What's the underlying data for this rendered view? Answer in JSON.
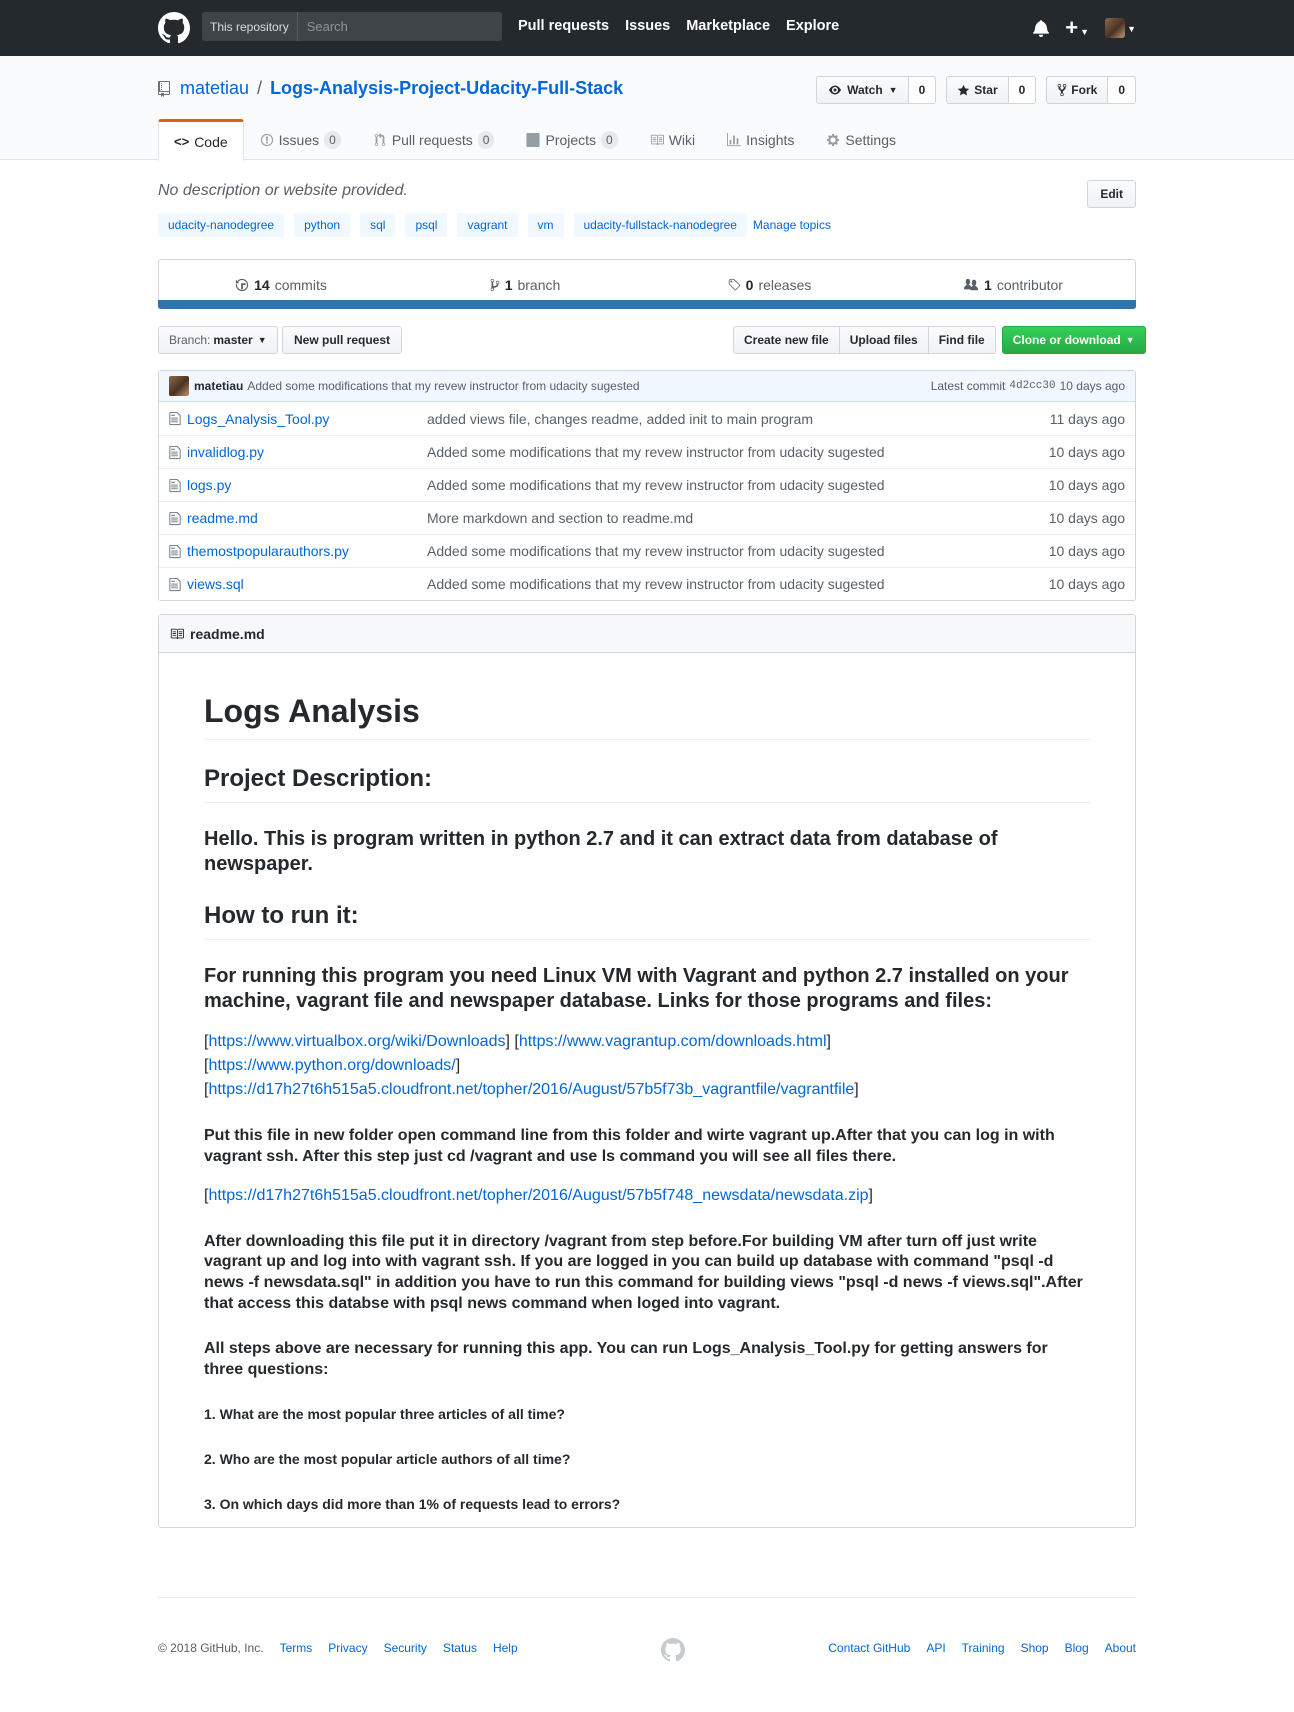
{
  "header": {
    "search_scope": "This repository",
    "search_placeholder": "Search",
    "nav": [
      "Pull requests",
      "Issues",
      "Marketplace",
      "Explore"
    ]
  },
  "repo": {
    "owner": "matetiau",
    "separator": "/",
    "name": "Logs-Analysis-Project-Udacity-Full-Stack",
    "watch_label": "Watch",
    "watch_count": "0",
    "star_label": "Star",
    "star_count": "0",
    "fork_label": "Fork",
    "fork_count": "0"
  },
  "tabs": [
    {
      "label": "Code",
      "counter": ""
    },
    {
      "label": "Issues",
      "counter": "0"
    },
    {
      "label": "Pull requests",
      "counter": "0"
    },
    {
      "label": "Projects",
      "counter": "0"
    },
    {
      "label": "Wiki",
      "counter": ""
    },
    {
      "label": "Insights",
      "counter": ""
    },
    {
      "label": "Settings",
      "counter": ""
    }
  ],
  "description": "No description or website provided.",
  "edit_label": "Edit",
  "topics": [
    "udacity-nanodegree",
    "python",
    "sql",
    "psql",
    "vagrant",
    "vm",
    "udacity-fullstack-nanodegree"
  ],
  "manage_topics": "Manage topics",
  "summary": {
    "commits_count": "14",
    "commits_label": "commits",
    "branch_count": "1",
    "branch_label": "branch",
    "releases_count": "0",
    "releases_label": "releases",
    "contributor_count": "1",
    "contributor_label": "contributor"
  },
  "colors": {
    "language_bar": "#3572a5",
    "header_bg": "#24292e",
    "clone_green": "#28a745"
  },
  "filenav": {
    "branch_prefix": "Branch:",
    "branch_name": "master",
    "new_pr": "New pull request",
    "create_file": "Create new file",
    "upload": "Upload files",
    "find": "Find file",
    "clone": "Clone or download"
  },
  "commit_tease": {
    "author": "matetiau",
    "message": "Added some modifications that my revew instructor from udacity sugested",
    "latest_label": "Latest commit",
    "sha": "4d2cc30",
    "age": "10 days ago"
  },
  "files": [
    {
      "name": "Logs_Analysis_Tool.py",
      "message": "added views file, changes readme, added init to main program",
      "age": "11 days ago"
    },
    {
      "name": "invalidlog.py",
      "message": "Added some modifications that my revew instructor from udacity sugested",
      "age": "10 days ago"
    },
    {
      "name": "logs.py",
      "message": "Added some modifications that my revew instructor from udacity sugested",
      "age": "10 days ago"
    },
    {
      "name": "readme.md",
      "message": "More markdown and section to readme.md",
      "age": "10 days ago"
    },
    {
      "name": "themostpopularauthors.py",
      "message": "Added some modifications that my revew instructor from udacity sugested",
      "age": "10 days ago"
    },
    {
      "name": "views.sql",
      "message": "Added some modifications that my revew instructor from udacity sugested",
      "age": "10 days ago"
    }
  ],
  "readme": {
    "filename": "readme.md",
    "h1": "Logs Analysis",
    "h2_desc": "Project Description:",
    "h3_hello": "Hello. This is program written in python 2.7 and it can extract data from database of newspaper.",
    "h2_run": "How to run it:",
    "h3_run": "For running this program you need Linux VM with Vagrant and python 2.7 installed on your machine, vagrant file and newspaper database. Links for those programs and files:",
    "link1": "https://www.virtualbox.org/wiki/Downloads",
    "link2": "https://www.vagrantup.com/downloads.html",
    "link3": "https://www.python.org/downloads/",
    "link4": "https://d17h27t6h515a5.cloudfront.net/topher/2016/August/57b5f73b_vagrantfile/vagrantfile",
    "h4_vagrant": "Put this file in new folder open command line from this folder and wirte vagrant up.After that you can log in with vagrant ssh. After this step just cd /vagrant and use ls command you will see all files there.",
    "link5": "https://d17h27t6h515a5.cloudfront.net/topher/2016/August/57b5f748_newsdata/newsdata.zip",
    "h4_db": "After downloading this file put it in directory /vagrant from step before.For building VM after turn off just write vagrant up and log into with vagrant ssh. If you are logged in you can build up database with command \"psql -d news -f newsdata.sql\" in addition you have to run this command for building views \"psql -d news -f views.sql\".After that access this databse with psql news command when loged into vagrant.",
    "h4_steps": "All steps above are necessary for running this app. You can run Logs_Analysis_Tool.py for getting answers for three questions:",
    "q1": "1. What are the most popular three articles of all time?",
    "q2": "2. Who are the most popular article authors of all time?",
    "q3": "3. On which days did more than 1% of requests lead to errors?"
  },
  "footer": {
    "copyright": "© 2018 GitHub, Inc.",
    "left_links": [
      "Terms",
      "Privacy",
      "Security",
      "Status",
      "Help"
    ],
    "right_links": [
      "Contact GitHub",
      "API",
      "Training",
      "Shop",
      "Blog",
      "About"
    ]
  }
}
